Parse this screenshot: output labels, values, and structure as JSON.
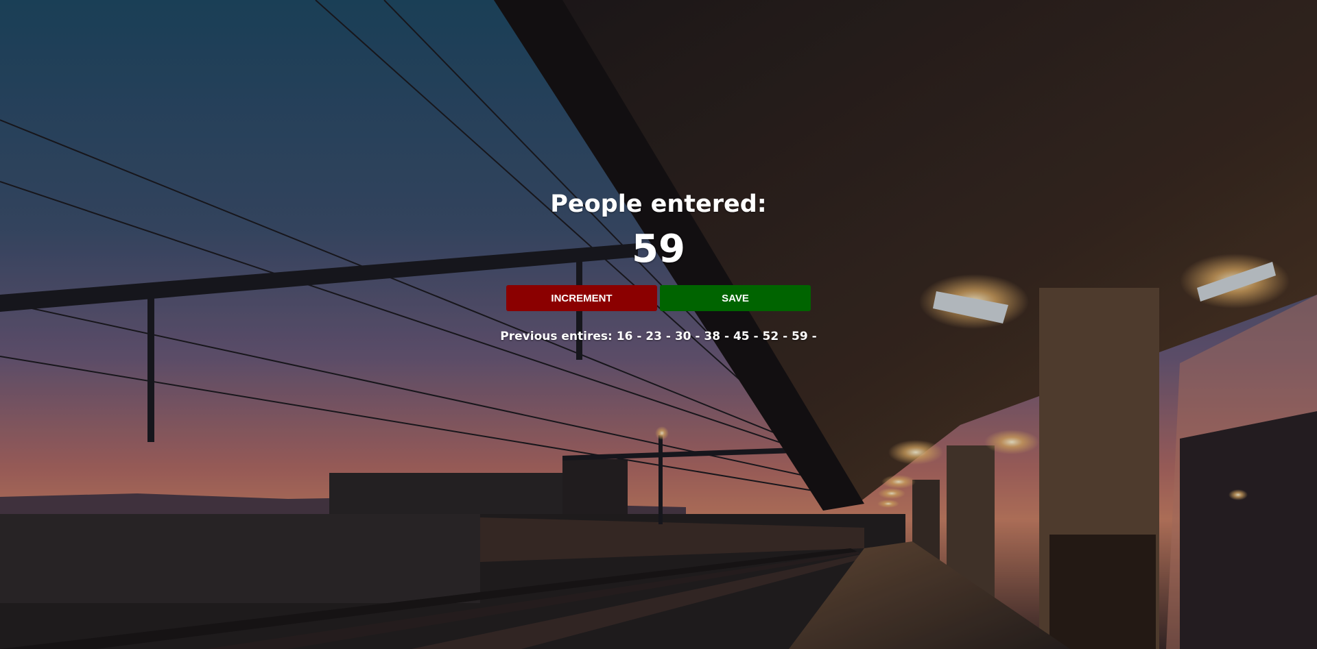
{
  "counter": {
    "title": "People entered:",
    "count": "59",
    "increment_label": "INCREMENT",
    "save_label": "SAVE",
    "previous_entries_label": "Previous entires:",
    "previous_entries_text": "16 - 23 - 30 - 38 - 45 - 52 - 59 -"
  },
  "colors": {
    "increment_button": "#8b0000",
    "save_button": "#006400",
    "text": "#ffffff"
  }
}
